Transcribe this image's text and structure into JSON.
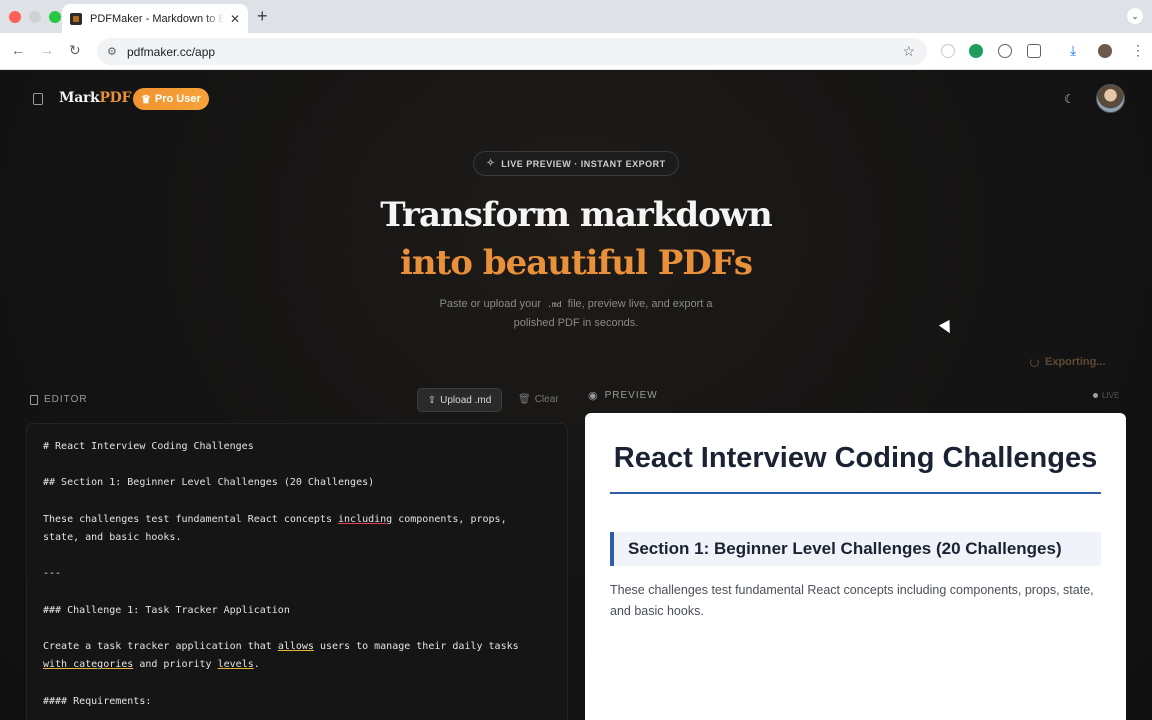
{
  "browser": {
    "tab_title": "PDFMaker - Markdown to Beautiful PDF",
    "url": "pdfmaker.cc/app"
  },
  "header": {
    "logo_part1": "Mark",
    "logo_part2": "PDF",
    "pro_badge": "Pro User"
  },
  "hero": {
    "pill": "LIVE PREVIEW · INSTANT EXPORT",
    "title_line1": "Transform markdown",
    "title_line2": "into beautiful PDFs",
    "sub_before": "Paste or upload your",
    "sub_code": ".md",
    "sub_after": "file, preview live, and export a polished PDF in seconds."
  },
  "export_status": "Exporting...",
  "editor": {
    "label": "EDITOR",
    "upload_label": "Upload .md",
    "clear_label": "Clear",
    "lines": {
      "l1": "# React Interview Coding Challenges",
      "l2": "## Section 1: Beginner Level Challenges (20 Challenges)",
      "l3a": "These challenges test fundamental React concepts ",
      "l3b": "including",
      "l3c": " components, props,",
      "l4": "state, and basic hooks.",
      "l5": "---",
      "l6": "### Challenge 1: Task Tracker Application",
      "l7a": "Create a task tracker application that ",
      "l7b": "allows",
      "l7c": " users to manage their daily tasks",
      "l8a": "with categories",
      "l8b": " and priority ",
      "l8c": "levels",
      "l8d": ".",
      "l9": "#### Requirements:"
    }
  },
  "preview": {
    "label": "PREVIEW",
    "live": "LIVE",
    "h1": "React Interview Coding Challenges",
    "h2": "Section 1: Beginner Level Challenges (20 Challenges)",
    "p": "These challenges test fundamental React concepts including components, props, state, and basic hooks."
  },
  "colors": {
    "accent": "#e9903a",
    "preview_rule": "#2d5fa8"
  }
}
